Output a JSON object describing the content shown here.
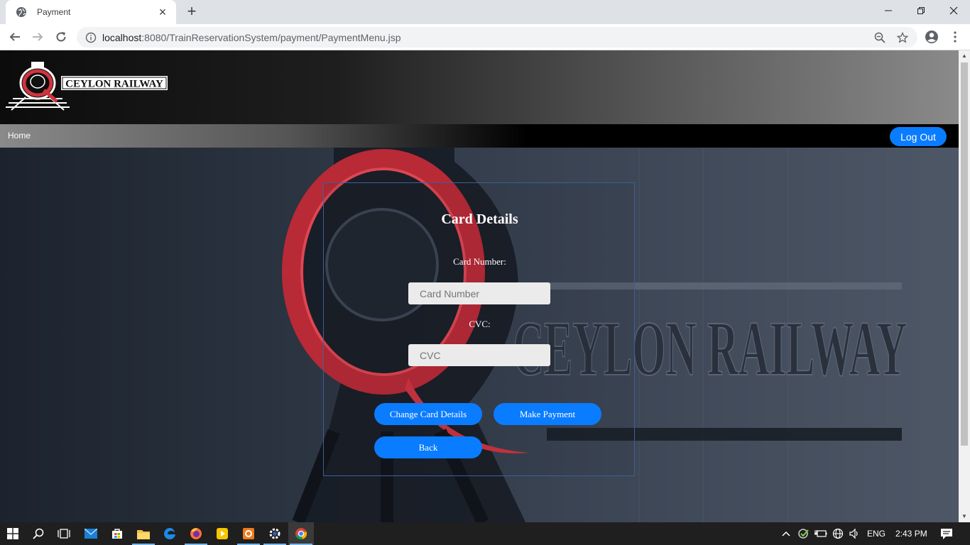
{
  "browser": {
    "tab_title": "Payment",
    "url_host": "localhost",
    "url_rest": ":8080/TrainReservationSystem/payment/PaymentMenu.jsp"
  },
  "site": {
    "logo_text": "CEYLON RAILWAY",
    "nav_home": "Home",
    "logout_label": "Log Out"
  },
  "card": {
    "title": "Card Details",
    "card_number_label": "Card Number:",
    "card_number_placeholder": "Card Number",
    "cvc_label": "CVC:",
    "cvc_placeholder": "CVC",
    "change_button": "Change Card Details",
    "pay_button": "Make Payment",
    "back_button": "Back"
  },
  "hero_sign_text": "CEYLON RAILWAY",
  "taskbar": {
    "language": "ENG",
    "time": "2:43 PM"
  },
  "colors": {
    "accent": "#0a7cff",
    "logo_red": "#d0343f"
  }
}
